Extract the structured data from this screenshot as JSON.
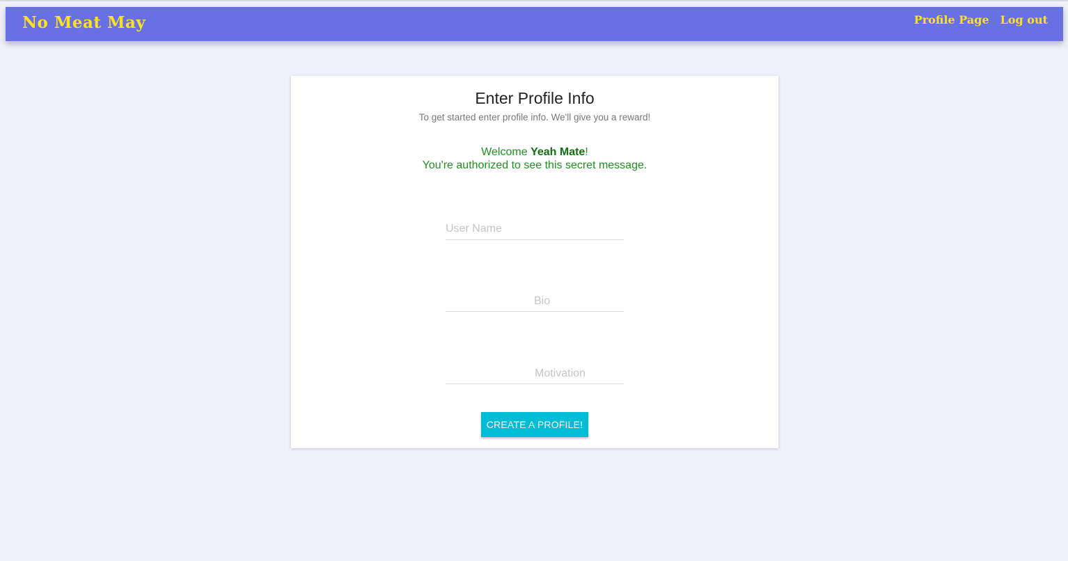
{
  "navbar": {
    "brand": "No Meat May",
    "links": [
      "Profile Page",
      "Log out"
    ]
  },
  "card": {
    "title": "Enter Profile Info",
    "subtitle": "To get started enter profile info. We'll give you a reward!",
    "welcome_prefix": "Welcome ",
    "welcome_name": "Yeah Mate",
    "welcome_suffix": "!",
    "secret_message": "You're authorized to see this secret message.",
    "fields": {
      "username_placeholder": "User Name",
      "bio_placeholder": "Bio",
      "motivation_placeholder": "Motivation"
    },
    "submit_label": "CREATE A PROFILE!"
  },
  "colors": {
    "navbar": "#6771e3",
    "brand_text": "#ffe022",
    "page_background": "#eff0fb",
    "welcome_text": "#1f8f1f",
    "button": "#00bcd4"
  }
}
